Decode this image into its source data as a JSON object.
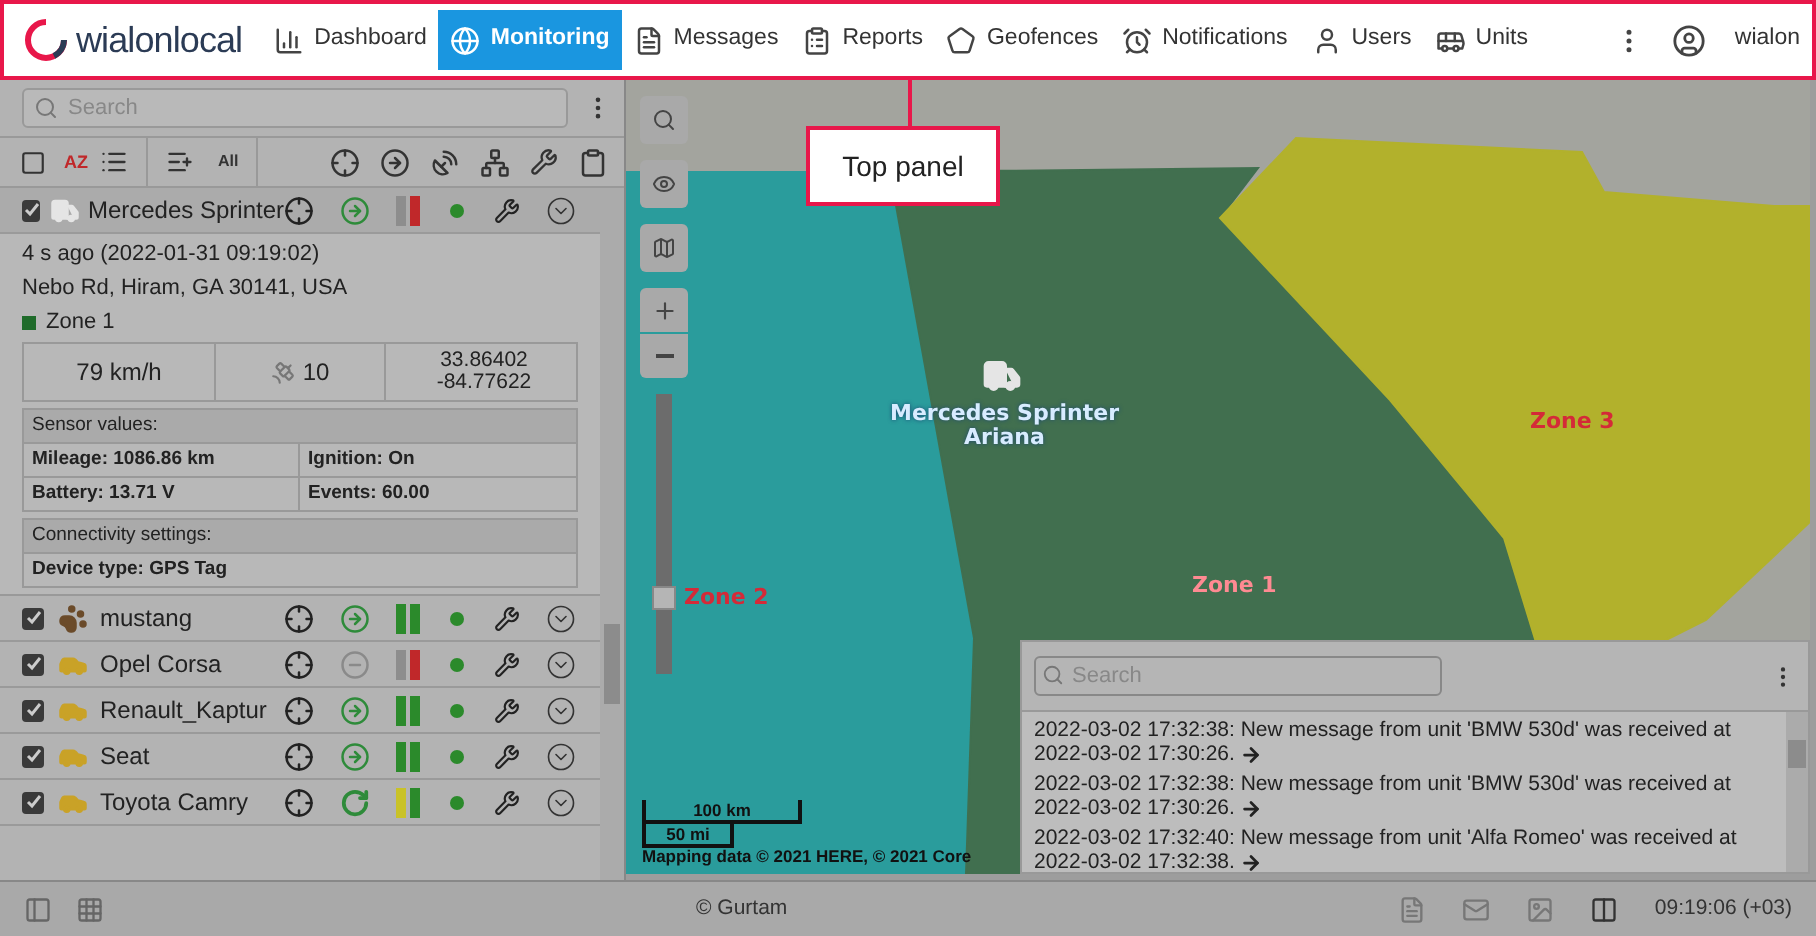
{
  "top_panel": {
    "logo": "wialonlocal",
    "nav": [
      {
        "label": "Dashboard",
        "selected": false
      },
      {
        "label": "Monitoring",
        "selected": true
      },
      {
        "label": "Messages",
        "selected": false
      },
      {
        "label": "Reports",
        "selected": false
      },
      {
        "label": "Geofences",
        "selected": false
      },
      {
        "label": "Notifications",
        "selected": false
      },
      {
        "label": "Users",
        "selected": false
      },
      {
        "label": "Units",
        "selected": false
      }
    ],
    "user": "wialon"
  },
  "callout": {
    "label": "Top panel"
  },
  "monitoring": {
    "search": {
      "placeholder": "Search"
    },
    "toolbar_sort_label": "AZ",
    "toolbar_all_label": "All",
    "selected_unit": {
      "name": "Mercedes Sprinter",
      "checked": true,
      "kind": "van",
      "moving": true,
      "turning": false,
      "alert": true,
      "warning": false,
      "last_message": "4 s ago (2022-01-31 09:19:02)",
      "address": "Nebo Rd, Hiram, GA 30141, USA",
      "zone": {
        "label": "Zone 1",
        "color": "#1f6b2a"
      },
      "speed": "79 km/h",
      "satellites": "10",
      "latitude": "33.86402",
      "longitude": "-84.77622",
      "sensors_title": "Sensor values:",
      "sensors": [
        "Mileage: 1086.86 km",
        "Ignition: On",
        "Battery: 13.71 V",
        "Events: 60.00"
      ],
      "connectivity_title": "Connectivity settings:",
      "connectivity": [
        "Device type: GPS Tag"
      ]
    },
    "units": [
      {
        "name": "mustang",
        "checked": true,
        "kind": "horse",
        "moving": true,
        "turning": false,
        "alert": false,
        "warning": false
      },
      {
        "name": "Opel Corsa",
        "checked": true,
        "kind": "car",
        "moving": false,
        "turning": false,
        "alert": true,
        "warning": false
      },
      {
        "name": "Renault_Kaptur",
        "checked": true,
        "kind": "car",
        "moving": true,
        "turning": false,
        "alert": false,
        "warning": false
      },
      {
        "name": "Seat",
        "checked": true,
        "kind": "car",
        "moving": true,
        "turning": false,
        "alert": false,
        "warning": false
      },
      {
        "name": "Toyota Camry",
        "checked": true,
        "kind": "car",
        "moving": true,
        "turning": true,
        "alert": false,
        "warning": true
      }
    ]
  },
  "map": {
    "unit_label": [
      "Mercedes Sprinter",
      "Ariana"
    ],
    "zones": [
      {
        "label": "Zone 2",
        "color": "#2a9c9c"
      },
      {
        "label": "Zone 1",
        "color": "#416f4f"
      },
      {
        "label": "Zone 3",
        "color": "#b2b12c"
      }
    ],
    "zoom_slider": {
      "level": 0.25
    },
    "scale": [
      "100 km",
      "50 mi"
    ],
    "attribution": "Mapping data © 2021 HERE, © 2021 Core"
  },
  "messages_panel": {
    "search": {
      "placeholder": "Search"
    },
    "messages": [
      "2022-03-02 17:32:38: New message from unit 'BMW 530d' was received at 2022-03-02 17:30:26.",
      "2022-03-02 17:32:38: New message from unit 'BMW 530d' was received at 2022-03-02 17:30:26.",
      "2022-03-02 17:32:40: New message from unit 'Alfa Romeo' was received at 2022-03-02 17:32:38."
    ]
  },
  "status_bar": {
    "copyright": "© Gurtam",
    "time": "09:19:06 (+03)"
  }
}
